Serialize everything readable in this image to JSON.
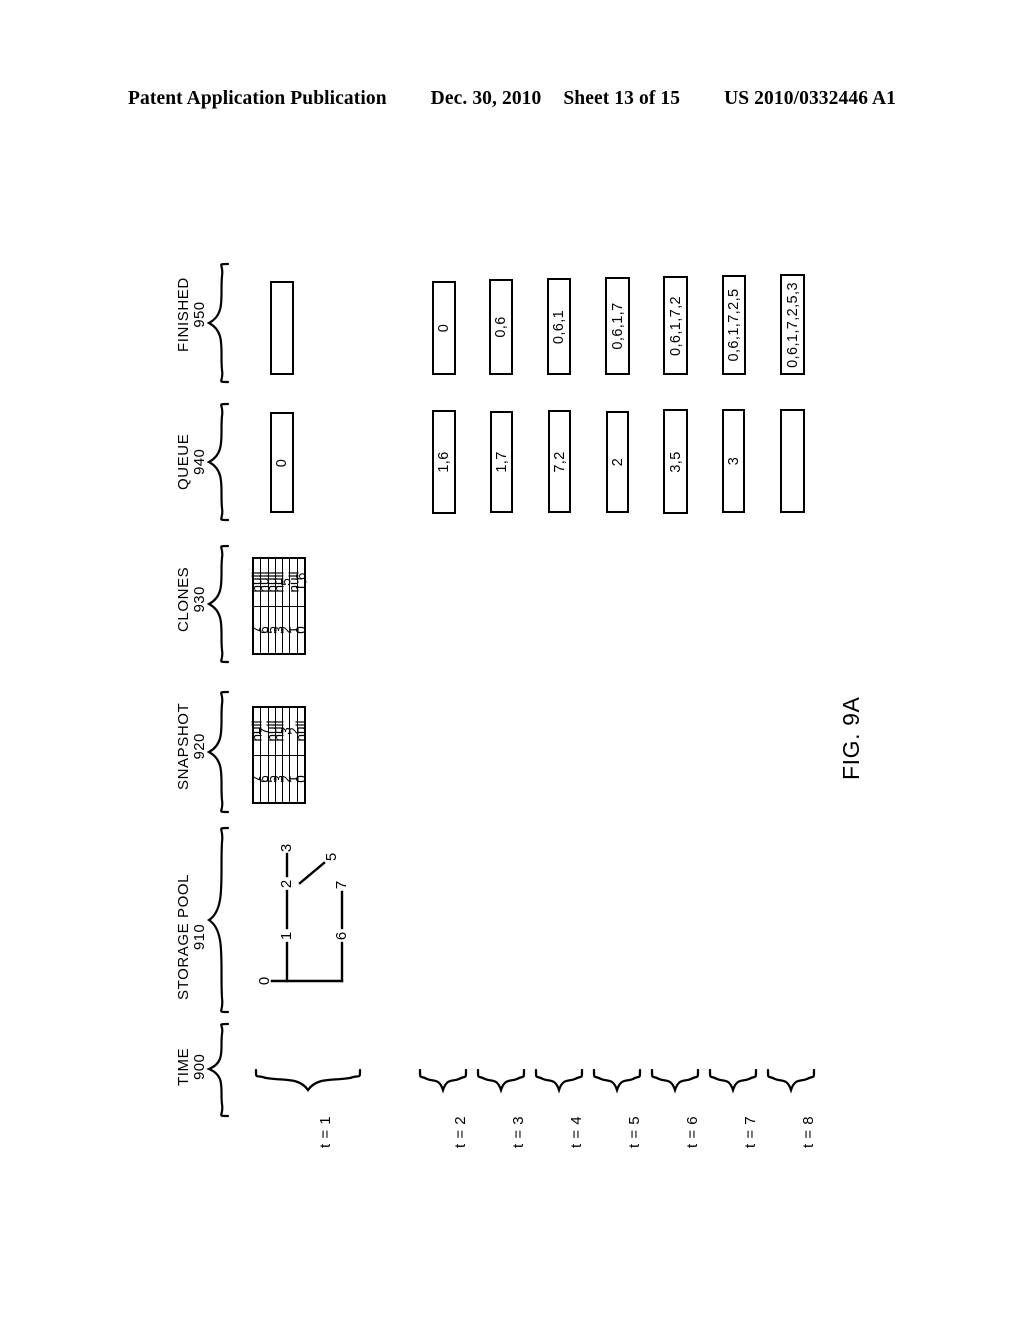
{
  "header": {
    "publication": "Patent Application Publication",
    "date": "Dec. 30, 2010",
    "sheet": "Sheet 13 of 15",
    "patent_number": "US 2010/0332446 A1"
  },
  "figure": {
    "caption": "FIG. 9A"
  },
  "sections": [
    {
      "label": "FINISHED",
      "ref": "950"
    },
    {
      "label": "QUEUE",
      "ref": "940"
    },
    {
      "label": "CLONES",
      "ref": "930"
    },
    {
      "label": "SNAPSHOT",
      "ref": "920"
    },
    {
      "label": "STORAGE POOL",
      "ref": "910"
    },
    {
      "label": "TIME",
      "ref": "900"
    }
  ],
  "time_steps": [
    {
      "label": "t = 1"
    },
    {
      "label": "t = 2"
    },
    {
      "label": "t = 3"
    },
    {
      "label": "t = 4"
    },
    {
      "label": "t = 5"
    },
    {
      "label": "t = 6"
    },
    {
      "label": "t = 7"
    },
    {
      "label": "t = 8"
    }
  ],
  "finished": {
    "values": [
      "",
      "0",
      "0,6",
      "0,6,1",
      "0,6,1,7",
      "0,6,1,7,2",
      "0,6,1,7,2,5",
      "0,6,1,7,2,5,3"
    ]
  },
  "queue": {
    "values": [
      "0",
      "1,6",
      "1,7",
      "7,2",
      "2",
      "3,5",
      "3",
      ""
    ]
  },
  "clones": {
    "keys": [
      "0",
      "1",
      "2",
      "3",
      "5",
      "6",
      "7"
    ],
    "values": [
      "1,6",
      "null",
      "5",
      "null",
      "null",
      "null",
      "null"
    ]
  },
  "snapshot": {
    "keys": [
      "0",
      "1",
      "2",
      "3",
      "5",
      "6",
      "7"
    ],
    "values": [
      "null",
      "2",
      "3",
      "null",
      "null",
      "7",
      "null"
    ]
  },
  "storage_pool": {
    "nodes": [
      "0",
      "1",
      "2",
      "3",
      "5",
      "6",
      "7"
    ],
    "edges": [
      {
        "from": "0",
        "to": "1"
      },
      {
        "from": "0",
        "to": "6"
      },
      {
        "from": "1",
        "to": "2"
      },
      {
        "from": "2",
        "to": "3"
      },
      {
        "from": "2",
        "to": "5"
      },
      {
        "from": "6",
        "to": "7"
      }
    ]
  },
  "colors": {
    "ink": "#000000",
    "paper": "#ffffff"
  }
}
